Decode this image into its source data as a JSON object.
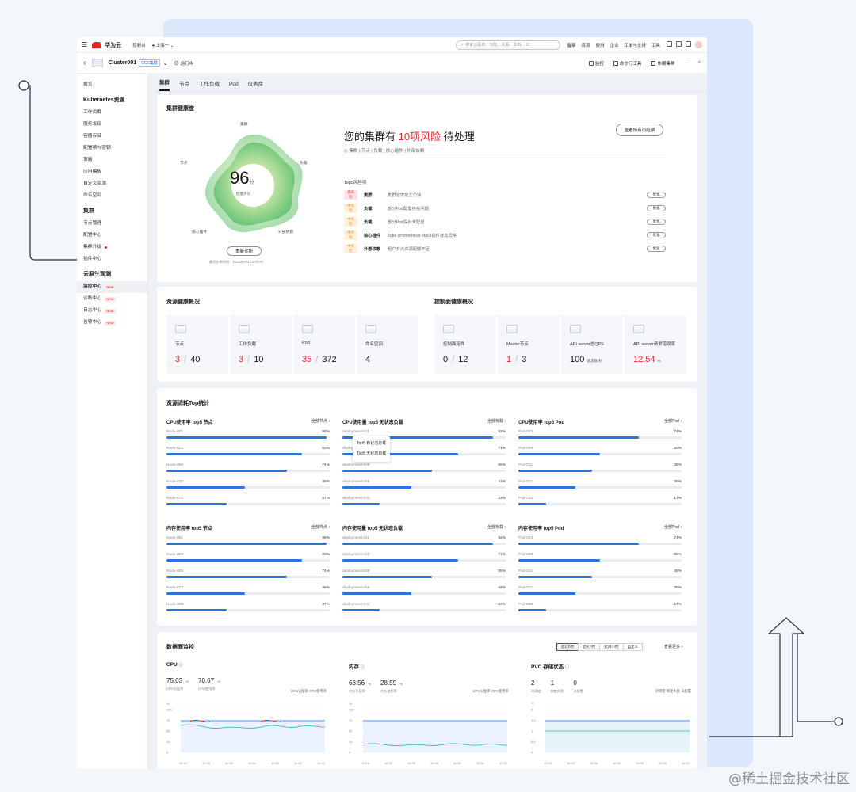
{
  "topbar": {
    "brand": "华为云",
    "console": "控制台",
    "region": "上海一",
    "search_placeholder": "搜索云服务、功能、资源、文档… 1/",
    "links": [
      "备案",
      "资源",
      "费用",
      "企业",
      "工单与支持",
      "工具"
    ]
  },
  "cluster": {
    "name": "Cluster001",
    "tag": "CCE集群",
    "status": "运行中",
    "actions": [
      "监控",
      "命令行工具",
      "休眠集群"
    ]
  },
  "sidebar": {
    "overview": "概览",
    "groups": [
      {
        "title": "Kubernetes资源",
        "items": [
          "工作负载",
          "服务发现",
          "容器存储",
          "配置项与密钥",
          "策略",
          "应用模板",
          "自定义资源",
          "命名空间"
        ]
      },
      {
        "title": "集群",
        "items": [
          "节点管理",
          "配置中心",
          "集群升级",
          "插件中心"
        ]
      },
      {
        "title": "云原生观测",
        "items": [
          "监控中心",
          "诊断中心",
          "日志中心",
          "告警中心"
        ]
      }
    ],
    "new_label": "NEW"
  },
  "tabs": [
    "集群",
    "节点",
    "工作负载",
    "Pod",
    "仪表盘"
  ],
  "health": {
    "title": "集群健康度",
    "score": "96",
    "score_unit": "分",
    "score_label": "健康评分",
    "axes": [
      "集群",
      "负载",
      "外部依赖",
      "核心插件",
      "节点"
    ],
    "rediagnose": "重新诊断",
    "last_check": "最近诊断时间：2023/04/04 12:00:00",
    "headline_pre": "您的集群有",
    "headline_count": "10项风险",
    "headline_post": "待处理",
    "subline": "集群 | 节点 | 负载 | 核心插件 | 外部依赖",
    "view_all": "查看所有风险项",
    "top5_label": "Top5风险项",
    "risks": [
      {
        "level": "高风险",
        "severity": "high",
        "cat": "集群",
        "desc": "集群容灾能力欠缺",
        "btn": "优化"
      },
      {
        "level": "中风险",
        "severity": "mid",
        "cat": "负载",
        "desc": "部分Pod配置存在问题",
        "btn": "优化"
      },
      {
        "level": "中风险",
        "severity": "mid",
        "cat": "负载",
        "desc": "部分Pod探针未配置",
        "btn": "优化"
      },
      {
        "level": "中风险",
        "severity": "mid",
        "cat": "核心插件",
        "desc": "kube-prometheus-stack插件状态异常",
        "btn": "优化"
      },
      {
        "level": "中风险",
        "severity": "mid",
        "cat": "外部依赖",
        "desc": "租户节点资源配额不足",
        "btn": "优化"
      }
    ]
  },
  "resource_health": {
    "title": "资源健康概况",
    "items": [
      {
        "name": "节点",
        "bad": "3",
        "total": "40"
      },
      {
        "name": "工作负载",
        "bad": "3",
        "total": "10"
      },
      {
        "name": "Pod",
        "bad": "35",
        "total": "372"
      },
      {
        "name": "命名空间",
        "bad": "",
        "total": "4"
      }
    ]
  },
  "control_health": {
    "title": "控制面健康概况",
    "items": [
      {
        "name": "控制面组件",
        "value": "0",
        "total": "12",
        "red": false
      },
      {
        "name": "Master节点",
        "value": "1",
        "total": "3",
        "red": true
      },
      {
        "name": "API server总QPS",
        "value": "100",
        "unit": "请求数/秒",
        "red": false
      },
      {
        "name": "API server请求错误率",
        "value": "12.54",
        "unit": "%",
        "red": true
      }
    ]
  },
  "top_stats": {
    "title": "资源消耗Top统计",
    "blocks": [
      {
        "title": "CPU使用率 top5 节点",
        "link": "全部节点",
        "rows": [
          [
            "Node-001",
            98
          ],
          [
            "Node-003",
            83
          ],
          [
            "Node-009",
            74
          ],
          [
            "Node-033",
            48
          ],
          [
            "Node-073",
            37
          ]
        ]
      },
      {
        "title": "CPU使用量 top5 无状态负载",
        "link": "全部负载",
        "rows": [
          [
            "deployment-011",
            92
          ],
          [
            "deployment-023",
            71
          ],
          [
            "deployment-009",
            55
          ],
          [
            "deployment-055",
            42
          ],
          [
            "deployment-031",
            23
          ]
        ]
      },
      {
        "title": "CPU使用率 top5 Pod",
        "link": "全部Pod",
        "rows": [
          [
            "Pod-003",
            74
          ],
          [
            "Pod-009",
            50
          ],
          [
            "Pod-011",
            45
          ],
          [
            "Pod-021",
            35
          ],
          [
            "Pod-036",
            17
          ]
        ]
      },
      {
        "title": "内存使用率 top5 节点",
        "link": "全部节点",
        "rows": [
          [
            "Node-001",
            98
          ],
          [
            "Node-003",
            83
          ],
          [
            "Node-005",
            74
          ],
          [
            "Node-023",
            48
          ],
          [
            "Node-073",
            37
          ]
        ]
      },
      {
        "title": "内存使用量 top5 无状态负载",
        "link": "全部负载",
        "rows": [
          [
            "deployment-011",
            92
          ],
          [
            "deployment-023",
            71
          ],
          [
            "deployment-009",
            55
          ],
          [
            "deployment-055",
            42
          ],
          [
            "deployment-031",
            23
          ]
        ]
      },
      {
        "title": "内存使用率 top5 Pod",
        "link": "全部Pod",
        "rows": [
          [
            "Pod-003",
            74
          ],
          [
            "Pod-009",
            50
          ],
          [
            "Pod-011",
            45
          ],
          [
            "Pod-021",
            35
          ],
          [
            "Pod-036",
            17
          ]
        ]
      }
    ],
    "tooltip": [
      "Top5 有状态负载",
      "Top5 无状态负载"
    ]
  },
  "monitoring": {
    "title": "数据面监控",
    "ranges": [
      "近1小时",
      "近6小时",
      "近24小时",
      "自定义"
    ],
    "more": "查看更多",
    "charts": [
      {
        "title": "CPU",
        "vals": [
          {
            "v": "75.03",
            "u": "%",
            "l": "CPU分配率"
          },
          {
            "v": "70.67",
            "u": "%",
            "l": "CPU使用率"
          }
        ],
        "legend": "CPU分配率  CPU使用率",
        "unit": "%",
        "yticks": [
          "100",
          "75",
          "50",
          "25",
          "0"
        ],
        "xticks": [
          "10:10",
          "10:20",
          "10:30",
          "10:40",
          "10:50",
          "11:00",
          "11:10"
        ]
      },
      {
        "title": "内存",
        "vals": [
          {
            "v": "68.56",
            "u": "%",
            "l": "内存分配率"
          },
          {
            "v": "28.59",
            "u": "%",
            "l": "内存使用率"
          }
        ],
        "legend": "CPU分配率  CPU使用率",
        "unit": "%",
        "yticks": [
          "100",
          "75",
          "50",
          "25",
          "0"
        ],
        "xticks": [
          "10:10",
          "10:20",
          "10:30",
          "10:40",
          "10:50",
          "11:00",
          "11:10"
        ]
      },
      {
        "title": "PVC 存储状态",
        "vals": [
          {
            "v": "2",
            "u": "",
            "l": "待绑定"
          },
          {
            "v": "1",
            "u": "",
            "l": "绑定失败"
          },
          {
            "v": "0",
            "u": "",
            "l": "未配置"
          }
        ],
        "legend": "待绑定  绑定失败  未配置",
        "unit": "个",
        "yticks": [
          "2",
          "1.5",
          "1",
          "0.5",
          "0"
        ],
        "xticks": [
          "10:10",
          "10:20",
          "10:30",
          "10:40",
          "10:50",
          "11:00",
          "11:10"
        ]
      }
    ]
  },
  "watermark": "@稀土掘金技术社区",
  "colors": {
    "accent": "#2b74de",
    "danger": "#e5262a",
    "warn": "#e8891c"
  }
}
